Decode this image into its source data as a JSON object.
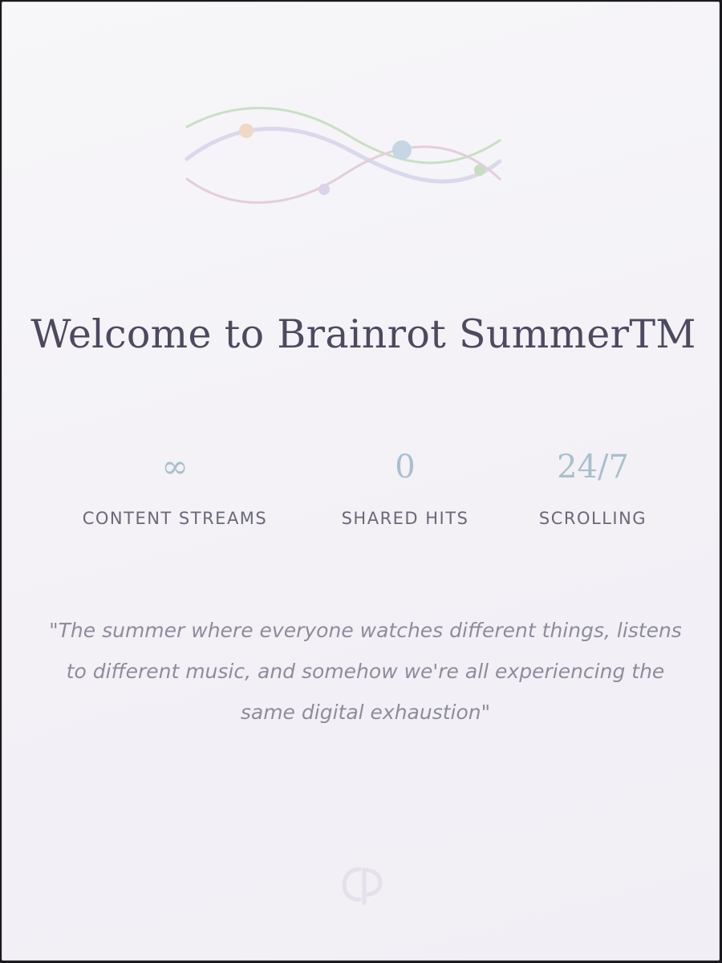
{
  "header": {
    "logo_icon": "wave-lines-icon"
  },
  "main": {
    "title": "Welcome to Brainrot SummerTM",
    "stats": [
      {
        "value": "∞",
        "label": "CONTENT STREAMS"
      },
      {
        "value": "0",
        "label": "SHARED HITS"
      },
      {
        "value": "24/7",
        "label": "SCROLLING"
      }
    ],
    "quote": "\"The summer where everyone watches different things, listens to different music, and somehow we're all experiencing the same digital exhaustion\""
  },
  "footer": {
    "logo_icon": "monogram-logo-icon"
  },
  "colors": {
    "background": "#f4f2f7",
    "title": "#4d4a5f",
    "stat_value": "#a9bfcd",
    "stat_label": "#6a6878",
    "quote": "#8e8c9b",
    "wave_green": "#c4dcbf",
    "wave_lavender": "#d8d4e8",
    "wave_pink": "#e0cbd8",
    "dot_orange": "#f0d4c0",
    "dot_blue": "#c3d3e0"
  }
}
